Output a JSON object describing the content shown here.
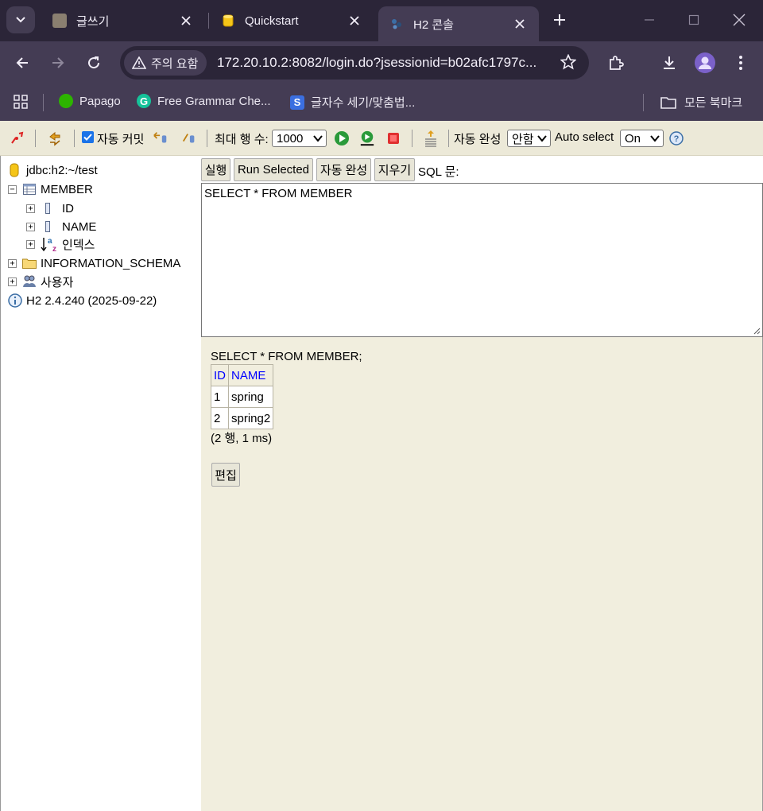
{
  "browser": {
    "tabs": [
      {
        "title": "글쓰기",
        "active": false
      },
      {
        "title": "Quickstart",
        "active": false
      },
      {
        "title": "H2 콘솔",
        "active": true
      }
    ],
    "security_chip": "주의 요함",
    "url": "172.20.10.2:8082/login.do?jsessionid=b02afc1797c...",
    "bookmarks": [
      {
        "label": "Papago",
        "icon": "papago-icon"
      },
      {
        "label": "Free Grammar Che...",
        "icon": "grammar-icon"
      },
      {
        "label": "글자수 세기/맞춤법...",
        "icon": "letter-count-icon"
      }
    ],
    "all_bookmarks": "모든 북마크"
  },
  "h2": {
    "toolbar": {
      "auto_commit_label": "자동 커밋",
      "auto_commit_checked": true,
      "max_rows_label": "최대 행 수:",
      "max_rows_value": "1000",
      "auto_complete_label": "자동 완성",
      "auto_complete_value": "안함",
      "auto_select_label": "Auto select",
      "auto_select_value": "On"
    },
    "tree": {
      "connection": "jdbc:h2:~/test",
      "table": "MEMBER",
      "columns": [
        "ID",
        "NAME"
      ],
      "indexes": "인덱스",
      "schema": "INFORMATION_SCHEMA",
      "users": "사용자",
      "version": "H2 2.4.240 (2025-09-22)"
    },
    "buttons": {
      "run": "실행",
      "run_selected": "Run Selected",
      "auto_complete": "자동 완성",
      "clear": "지우기",
      "sql_label": "SQL 문:"
    },
    "sql_text": "SELECT * FROM MEMBER",
    "result": {
      "sql": "SELECT * FROM MEMBER;",
      "columns": [
        "ID",
        "NAME"
      ],
      "rows": [
        [
          "1",
          "spring"
        ],
        [
          "2",
          "spring2"
        ]
      ],
      "summary": "(2 행, 1 ms)",
      "edit_button": "편집"
    }
  }
}
